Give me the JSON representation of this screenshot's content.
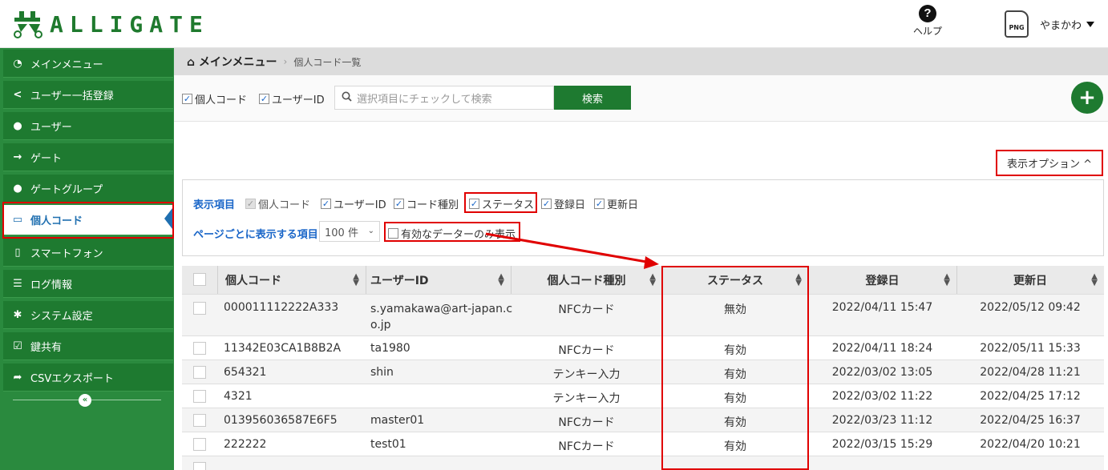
{
  "header": {
    "logo_text": "ALLIGATE",
    "help_label": "ヘルプ",
    "avatar_text": "PNG",
    "username": "やまかわ"
  },
  "sidebar": {
    "items": [
      {
        "label": "メインメニュー",
        "icon": "dashboard-icon"
      },
      {
        "label": "ユーザー一括登録",
        "icon": "share-icon"
      },
      {
        "label": "ユーザー",
        "icon": "user-icon"
      },
      {
        "label": "ゲート",
        "icon": "sign-in-icon"
      },
      {
        "label": "ゲートグループ",
        "icon": "users-icon"
      },
      {
        "label": "個人コード",
        "icon": "card-icon"
      },
      {
        "label": "スマートフォン",
        "icon": "phone-icon"
      },
      {
        "label": "ログ情報",
        "icon": "list-icon"
      },
      {
        "label": "システム設定",
        "icon": "gear-icon"
      },
      {
        "label": "鍵共有",
        "icon": "check-square-icon"
      },
      {
        "label": "CSVエクスポート",
        "icon": "share-arrow-icon"
      }
    ],
    "collapse_glyph": "«"
  },
  "breadcrumb": {
    "home": "メインメニュー",
    "current": "個人コード一覧"
  },
  "search": {
    "filters": [
      {
        "label": "個人コード",
        "checked": true
      },
      {
        "label": "ユーザーID",
        "checked": true
      }
    ],
    "placeholder": "選択項目にチェックして検索",
    "button_label": "検索"
  },
  "display_option_label": "表示オプション ^",
  "options": {
    "display_items_label": "表示項目",
    "display_items": [
      {
        "label": "個人コード",
        "checked": true,
        "disabled": true
      },
      {
        "label": "ユーザーID",
        "checked": true
      },
      {
        "label": "コード種別",
        "checked": true
      },
      {
        "label": "ステータス",
        "checked": true
      },
      {
        "label": "登録日",
        "checked": true
      },
      {
        "label": "更新日",
        "checked": true
      }
    ],
    "per_page_label": "ページごとに表示する項目",
    "per_page_value": "100 件",
    "valid_only_label": "有効なデーターのみ表示",
    "valid_only_checked": false
  },
  "table": {
    "columns": [
      "個人コード",
      "ユーザーID",
      "個人コード種別",
      "ステータス",
      "登録日",
      "更新日"
    ],
    "rows": [
      [
        "000011112222A333",
        "s.yamakawa@art-japan.c",
        "NFCカード",
        "無効",
        "2022/04/11 15:47",
        "2022/05/12 09:42",
        "o.jp"
      ],
      [
        "11342E03CA1B8B2A",
        "ta1980",
        "NFCカード",
        "有効",
        "2022/04/11 18:24",
        "2022/05/11 15:33",
        ""
      ],
      [
        "654321",
        "shin",
        "テンキー入力",
        "有効",
        "2022/03/02 13:05",
        "2022/04/28 11:21",
        ""
      ],
      [
        "4321",
        "",
        "テンキー入力",
        "有効",
        "2022/03/02 11:22",
        "2022/04/25 17:12",
        ""
      ],
      [
        "013956036587E6F5",
        "master01",
        "NFCカード",
        "有効",
        "2022/03/23 11:12",
        "2022/04/25 16:37",
        ""
      ],
      [
        "222222",
        "test01",
        "NFCカード",
        "有効",
        "2022/03/15 15:29",
        "2022/04/20 10:21",
        ""
      ]
    ]
  },
  "colors": {
    "brand_green": "#1e7a30",
    "sidebar_green": "#2a8a3e",
    "highlight_red": "#e00000",
    "link_blue": "#1a66c8"
  }
}
